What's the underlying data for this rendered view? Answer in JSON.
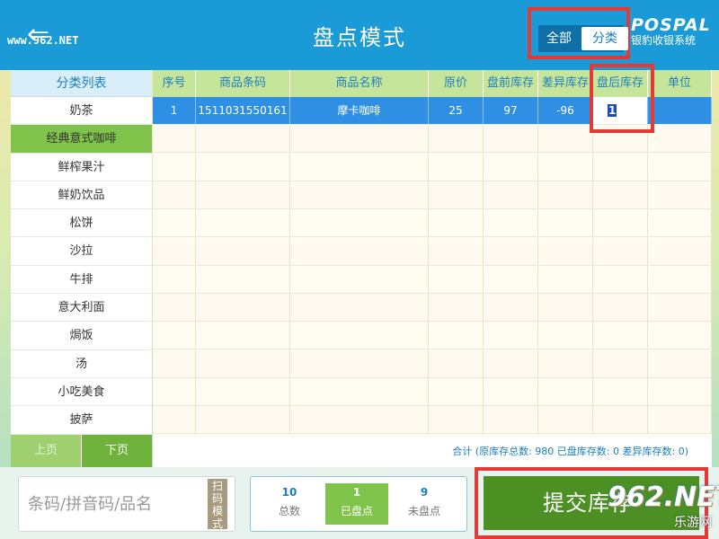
{
  "header": {
    "title": "盘点模式",
    "watermark": "www.962.NET",
    "mode_all": "全部",
    "mode_category": "分类",
    "logo_main": "POSPAL",
    "logo_sub": "银豹收银系统"
  },
  "sidebar": {
    "header": "分类列表",
    "items": [
      "奶茶",
      "经典意式咖啡",
      "鲜榨果汁",
      "鲜奶饮品",
      "松饼",
      "沙拉",
      "牛排",
      "意大利面",
      "焗饭",
      "汤",
      "小吃美食",
      "披萨"
    ],
    "active_index": 1,
    "prev_page": "上页",
    "next_page": "下页"
  },
  "table": {
    "columns": [
      "序号",
      "商品条码",
      "商品名称",
      "原价",
      "盘前库存",
      "差异库存",
      "盘后库存",
      "单位"
    ],
    "rows": [
      {
        "index": "1",
        "barcode": "1511031550161",
        "name": "摩卡咖啡",
        "price": "25",
        "stock_before": "97",
        "stock_diff": "-96",
        "stock_after": "1",
        "unit": ""
      }
    ],
    "summary": "合计 (原库存总数: 980 已盘库存数: 0 差异库存数: 0)"
  },
  "bottom": {
    "search_placeholder": "条码/拼音码/品名",
    "scan_mode": "扫码模式",
    "stats": [
      {
        "value": "10",
        "label": "总数"
      },
      {
        "value": "1",
        "label": "已盘点"
      },
      {
        "value": "9",
        "label": "未盘点"
      }
    ],
    "submit_label": "提交库存",
    "watermark_main": "962.NET",
    "watermark_sub": "乐游网"
  },
  "colors": {
    "header_bg": "#1a9ad6",
    "accent_green": "#7fc34a",
    "submit_green": "#4c8f22",
    "selected_row": "#2f8fe3",
    "highlight_red": "#e53935"
  }
}
